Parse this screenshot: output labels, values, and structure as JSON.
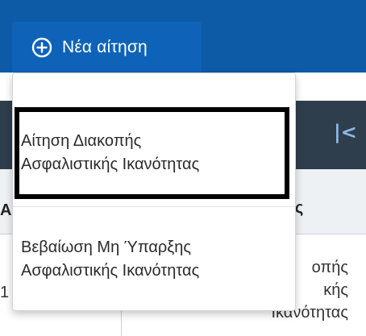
{
  "toolbar": {
    "new_request_label": "Νέα αίτηση",
    "new_request_icon": "plus-circle-icon"
  },
  "menu": {
    "items": [
      {
        "line1": "Αίτηση Διακοπής",
        "line2": "Ασφαλιστικής Ικανότητας"
      },
      {
        "line1": "Βεβαίωση Μη Ύπαρξης",
        "line2": "Ασφαλιστικής Ικανότητας"
      }
    ]
  },
  "background": {
    "prev_arrow": "|<",
    "column_header_fragment": "σης",
    "column_header_left_fragment": "Α",
    "cell_fragment_line1": "οπής",
    "cell_fragment_line2": "κής",
    "cell_fragment_line3": "Ικανότητας",
    "left_stub": "1"
  },
  "colors": {
    "topbar": "#0d5aa7",
    "button": "#0e63b8",
    "highlight_border": "#000000",
    "dark_row": "#2f3e4c"
  }
}
